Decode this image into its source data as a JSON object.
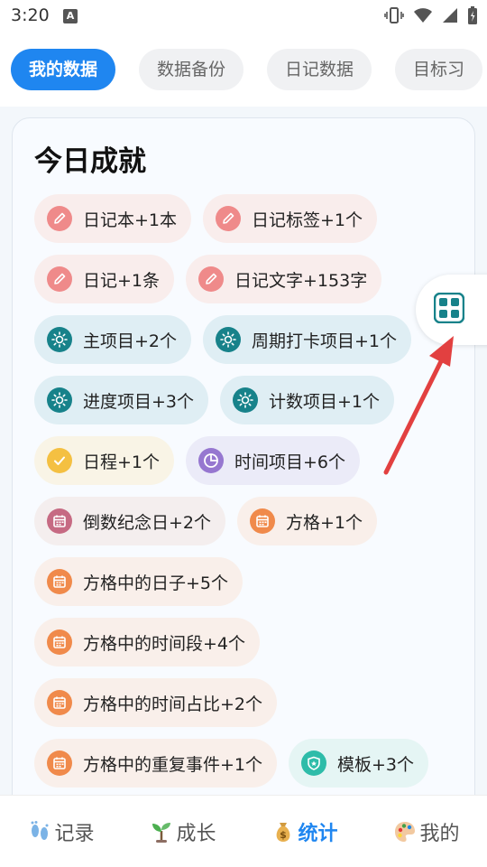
{
  "status_bar": {
    "time": "3:20",
    "notification_letter": "A"
  },
  "tabs": [
    {
      "label": "我的数据",
      "active": true
    },
    {
      "label": "数据备份",
      "active": false
    },
    {
      "label": "日记数据",
      "active": false
    },
    {
      "label": "目标习",
      "active": false
    }
  ],
  "card": {
    "title": "今日成就",
    "rows": [
      [
        {
          "icon": "pencil-icon",
          "type": "diary",
          "label": "日记本+1本"
        },
        {
          "icon": "pencil-icon",
          "type": "diary",
          "label": "日记标签+1个"
        }
      ],
      [
        {
          "icon": "pencil-icon",
          "type": "diary",
          "label": "日记+1条"
        },
        {
          "icon": "pencil-icon",
          "type": "diary",
          "label": "日记文字+153字"
        }
      ],
      [
        {
          "icon": "sun-icon",
          "type": "project",
          "label": "主项目+2个"
        },
        {
          "icon": "sun-icon",
          "type": "project",
          "label": "周期打卡项目+1个"
        }
      ],
      [
        {
          "icon": "sun-icon",
          "type": "project",
          "label": "进度项目+3个"
        },
        {
          "icon": "sun-icon",
          "type": "project",
          "label": "计数项目+1个"
        }
      ],
      [
        {
          "icon": "check-icon",
          "type": "schedule",
          "label": "日程+1个"
        },
        {
          "icon": "pie-clock-icon",
          "type": "time",
          "label": "时间项目+6个"
        }
      ],
      [
        {
          "icon": "calendar-icon",
          "type": "countdown",
          "label": "倒数纪念日+2个"
        },
        {
          "icon": "calendar-icon",
          "type": "grid",
          "label": "方格+1个"
        }
      ],
      [
        {
          "icon": "calendar-icon",
          "type": "grid",
          "label": "方格中的日子+5个"
        }
      ],
      [
        {
          "icon": "calendar-icon",
          "type": "grid",
          "label": "方格中的时间段+4个"
        }
      ],
      [
        {
          "icon": "calendar-icon",
          "type": "grid",
          "label": "方格中的时间占比+2个"
        }
      ],
      [
        {
          "icon": "calendar-icon",
          "type": "grid",
          "label": "方格中的重复事件+1个"
        },
        {
          "icon": "shield-icon",
          "type": "template",
          "label": "模板+3个"
        }
      ]
    ]
  },
  "floating_button": {
    "icon": "grid-layout-icon"
  },
  "bottom_nav": [
    {
      "icon": "footprints-icon",
      "label": "记录",
      "active": false
    },
    {
      "icon": "sprout-icon",
      "label": "成长",
      "active": false
    },
    {
      "icon": "money-bag-icon",
      "label": "统计",
      "active": true
    },
    {
      "icon": "palette-icon",
      "label": "我的",
      "active": false
    }
  ],
  "colors": {
    "accent": "#1f86f0",
    "diary": "#ef8a8a",
    "project": "#17828a",
    "schedule": "#f4c042",
    "time": "#9677d0",
    "countdown": "#c66a83",
    "grid": "#f08a4b",
    "template": "#2ebca9",
    "arrow": "#e24040"
  }
}
